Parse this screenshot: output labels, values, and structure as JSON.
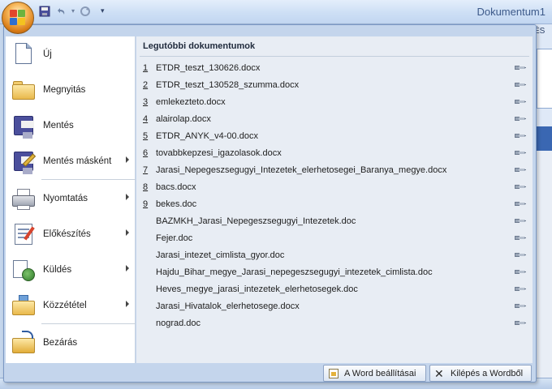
{
  "window": {
    "title": "Dokumentum1"
  },
  "quick_access": {
    "items": [
      "save-icon",
      "undo-icon",
      "redo-icon"
    ],
    "more": "▾"
  },
  "background": {
    "tab_partial": "ÉS"
  },
  "left_menu": [
    {
      "label": "Új",
      "icon": "new-document-icon",
      "has_submenu": false
    },
    {
      "label": "Megnyitás",
      "icon": "open-folder-icon",
      "has_submenu": false
    },
    {
      "label": "Mentés",
      "icon": "save-icon",
      "has_submenu": false
    },
    {
      "label": "Mentés másként",
      "icon": "save-as-icon",
      "has_submenu": true
    },
    {
      "label": "Nyomtatás",
      "icon": "print-icon",
      "has_submenu": true
    },
    {
      "label": "Előkészítés",
      "icon": "prepare-icon",
      "has_submenu": true
    },
    {
      "label": "Küldés",
      "icon": "send-icon",
      "has_submenu": true
    },
    {
      "label": "Közzététel",
      "icon": "publish-icon",
      "has_submenu": true
    },
    {
      "label": "Bezárás",
      "icon": "close-document-icon",
      "has_submenu": false
    }
  ],
  "recent": {
    "title": "Legutóbbi dokumentumok",
    "items": [
      {
        "num": "1",
        "name": "ETDR_teszt_130626.docx"
      },
      {
        "num": "2",
        "name": "ETDR_teszt_130528_szumma.docx"
      },
      {
        "num": "3",
        "name": "emlekezteto.docx"
      },
      {
        "num": "4",
        "name": "alairolap.docx"
      },
      {
        "num": "5",
        "name": "ETDR_ANYK_v4-00.docx"
      },
      {
        "num": "6",
        "name": "tovabbkepzesi_igazolasok.docx"
      },
      {
        "num": "7",
        "name": "Jarasi_Nepegeszsegugyi_Intezetek_elerhetosegei_Baranya_megye.docx"
      },
      {
        "num": "8",
        "name": "bacs.docx"
      },
      {
        "num": "9",
        "name": "bekes.doc"
      },
      {
        "num": "",
        "name": "BAZMKH_Jarasi_Nepegeszsegugyi_Intezetek.doc"
      },
      {
        "num": "",
        "name": "Fejer.doc"
      },
      {
        "num": "",
        "name": "Jarasi_intezet_cimlista_gyor.doc"
      },
      {
        "num": "",
        "name": "Hajdu_Bihar_megye_Jarasi_nepegeszsegugyi_intezetek_cimlista.doc"
      },
      {
        "num": "",
        "name": "Heves_megye_jarasi_intezetek_elerhetosegek.doc"
      },
      {
        "num": "",
        "name": "Jarasi_Hivatalok_elerhetosege.docx"
      },
      {
        "num": "",
        "name": "nograd.doc"
      }
    ]
  },
  "buttons": {
    "options_label": "A Word beállításai",
    "exit_label": "Kilépés a Wordből"
  }
}
